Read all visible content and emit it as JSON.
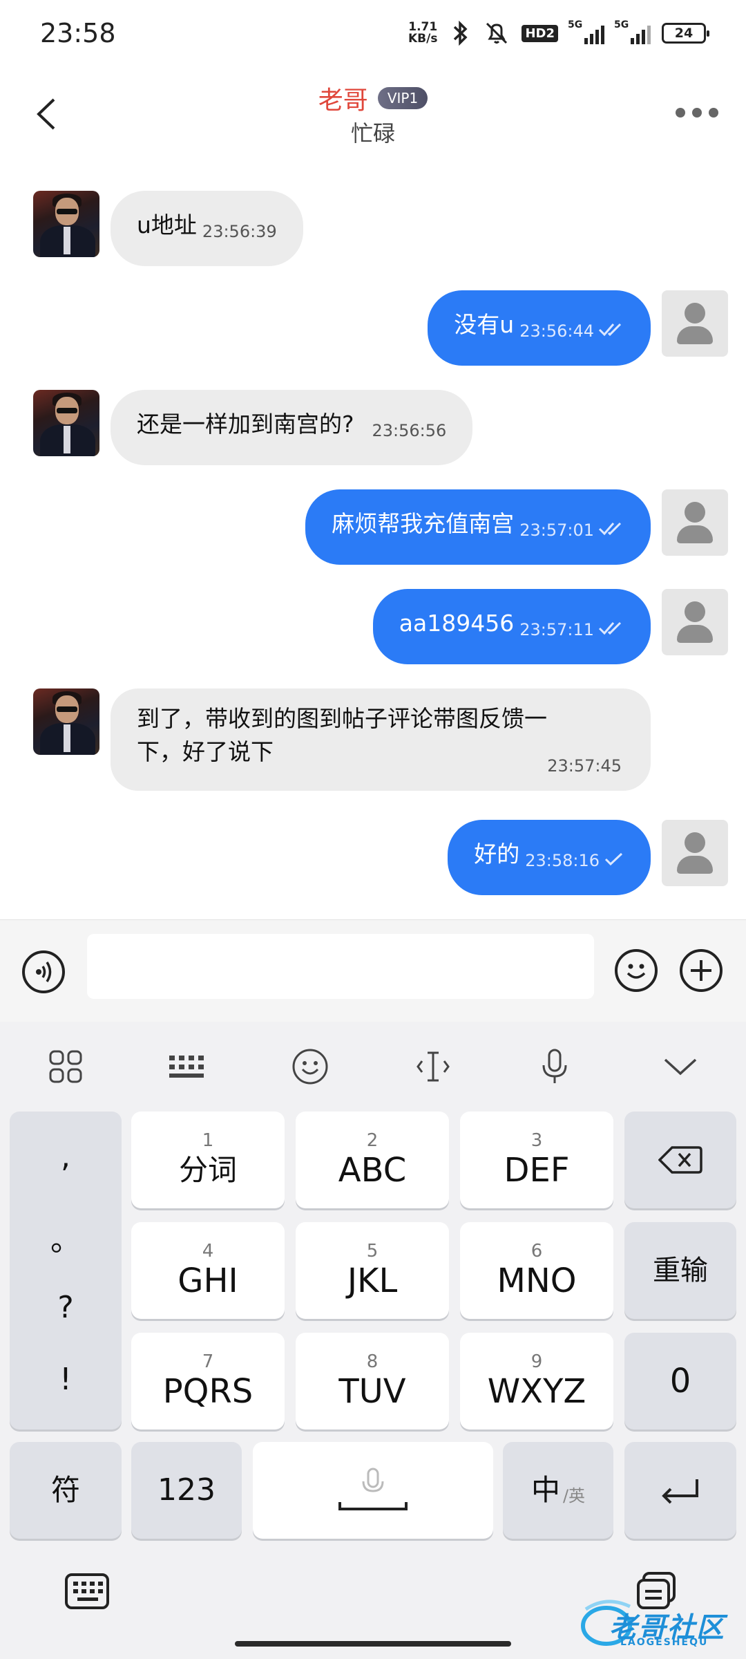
{
  "status_bar": {
    "time": "23:58",
    "net_speed_value": "1.71",
    "net_speed_unit": "KB/s",
    "hd_label": "HD2",
    "sim1_label": "5G",
    "sim2_label": "5G",
    "battery": "24"
  },
  "header": {
    "title": "老哥",
    "badge": "VIP1",
    "subtitle": "忙碌"
  },
  "messages": [
    {
      "dir": "in",
      "text": "u地址",
      "time": "23:56:39"
    },
    {
      "dir": "out",
      "text": "没有u",
      "time": "23:56:44",
      "status": "read"
    },
    {
      "dir": "in",
      "text": "还是一样加到南宫的?",
      "time": "23:56:56"
    },
    {
      "dir": "out",
      "text": "麻烦帮我充值南宫",
      "time": "23:57:01",
      "status": "read"
    },
    {
      "dir": "out",
      "text": "aa189456",
      "time": "23:57:11",
      "status": "read"
    },
    {
      "dir": "in",
      "text_line1": "到了，带收到的图到帖子评论带图反馈一",
      "text_line2": "下，好了说下",
      "time": "23:57:45"
    },
    {
      "dir": "out",
      "text": "好的",
      "time": "23:58:16",
      "status": "sent"
    }
  ],
  "input_bar": {
    "placeholder": ""
  },
  "keyboard": {
    "toolbar_icons": [
      "grid-icon",
      "keyboard-layout-icon",
      "emoji-icon",
      "cursor-icon",
      "microphone-icon",
      "collapse-chevron-icon"
    ],
    "punctuation": [
      ",",
      "。",
      "?",
      "!"
    ],
    "keys": [
      {
        "num": "1",
        "label": "分词"
      },
      {
        "num": "2",
        "label": "ABC"
      },
      {
        "num": "3",
        "label": "DEF"
      },
      {
        "num": "4",
        "label": "GHI"
      },
      {
        "num": "5",
        "label": "JKL"
      },
      {
        "num": "6",
        "label": "MNO"
      },
      {
        "num": "7",
        "label": "PQRS"
      },
      {
        "num": "8",
        "label": "TUV"
      },
      {
        "num": "9",
        "label": "WXYZ"
      }
    ],
    "reenter_label": "重输",
    "zero_label": "0",
    "symbols_label": "符",
    "numbers_label": "123",
    "lang_main": "中",
    "lang_alt": "/英"
  },
  "watermark": {
    "text": "老哥社区",
    "subtext": "LAOGESHEQU"
  },
  "colors": {
    "accent_blue": "#2b7bf6",
    "title_red": "#e0473b",
    "incoming_bubble": "#ececec"
  }
}
